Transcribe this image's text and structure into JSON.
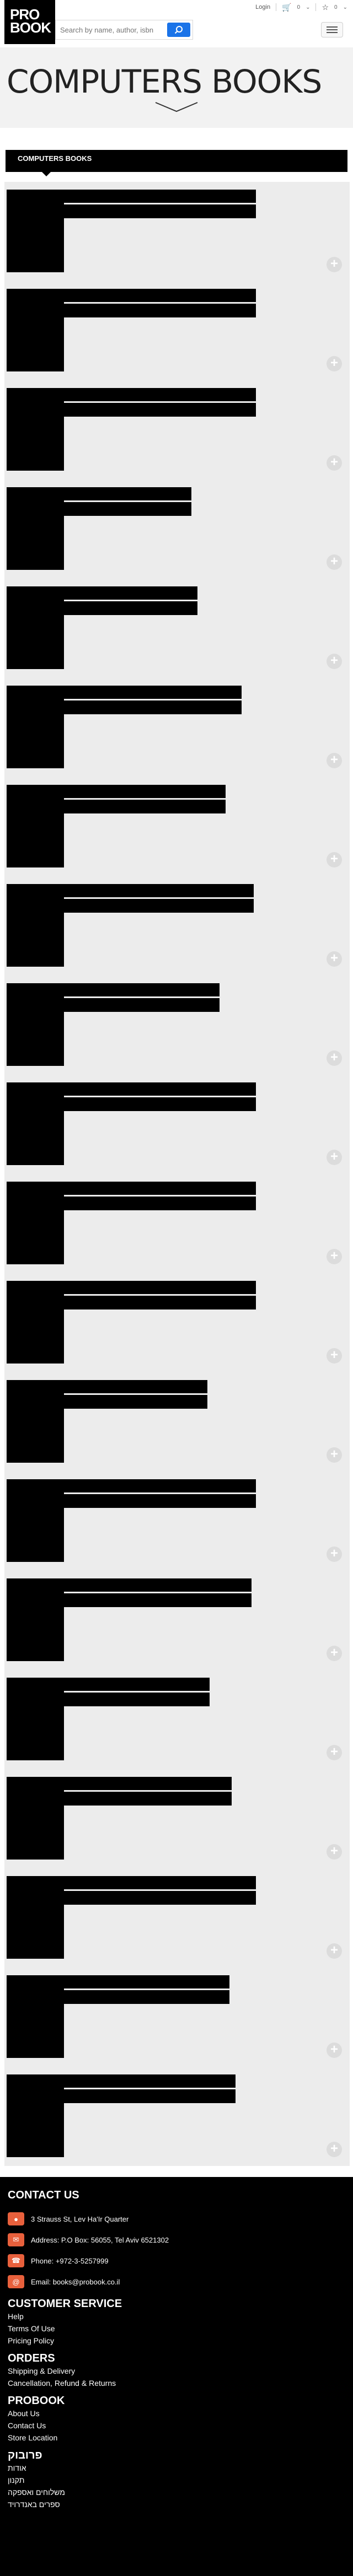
{
  "header": {
    "logo_line1": "PRO",
    "logo_line2": "BOOK",
    "login": "Login",
    "cart_count": "0",
    "wishlist_count": "0",
    "search_placeholder": "Search by name, author, isbn"
  },
  "banner": {
    "title": "COMPUTERS BOOKS"
  },
  "section": {
    "title": "COMPUTERS BOOKS"
  },
  "books": [
    {
      "title_width_pct": 95
    },
    {
      "title_width_pct": 95
    },
    {
      "title_width_pct": 95
    },
    {
      "title_width_pct": 63
    },
    {
      "title_width_pct": 66
    },
    {
      "title_width_pct": 88
    },
    {
      "title_width_pct": 80
    },
    {
      "title_width_pct": 94
    },
    {
      "title_width_pct": 77
    },
    {
      "title_width_pct": 95
    },
    {
      "title_width_pct": 95
    },
    {
      "title_width_pct": 95
    },
    {
      "title_width_pct": 71
    },
    {
      "title_width_pct": 95
    },
    {
      "title_width_pct": 93
    },
    {
      "title_width_pct": 72
    },
    {
      "title_width_pct": 83
    },
    {
      "title_width_pct": 95
    },
    {
      "title_width_pct": 82
    },
    {
      "title_width_pct": 85
    }
  ],
  "footer": {
    "contact_title": "CONTACT US",
    "contacts": [
      {
        "icon": "location-icon",
        "text": "3 Strauss St, Lev Ha'Ir Quarter"
      },
      {
        "icon": "mailbox-icon",
        "text": "Address: P.O Box: 56055, Tel Aviv 6521302"
      },
      {
        "icon": "phone-icon",
        "text": "Phone: +972-3-5257999"
      },
      {
        "icon": "email-icon",
        "text": "Email: books@probook.co.il"
      }
    ],
    "customer_service_title": "CUSTOMER SERVICE",
    "customer_service_links": [
      "Help",
      "Terms Of Use",
      "Pricing Policy"
    ],
    "orders_title": "ORDERS",
    "orders_links": [
      "Shipping & Delivery",
      "Cancellation, Refund & Returns"
    ],
    "probook_title": "PROBOOK",
    "probook_links": [
      "About Us",
      "Contact Us",
      "Store Location"
    ],
    "hebrew_title": "פרובוק",
    "hebrew_links": [
      "אודות",
      "תקנון",
      "משלוחים ואספקה",
      "ספרים באנדרויד"
    ],
    "accent_color": "#e8603c"
  }
}
